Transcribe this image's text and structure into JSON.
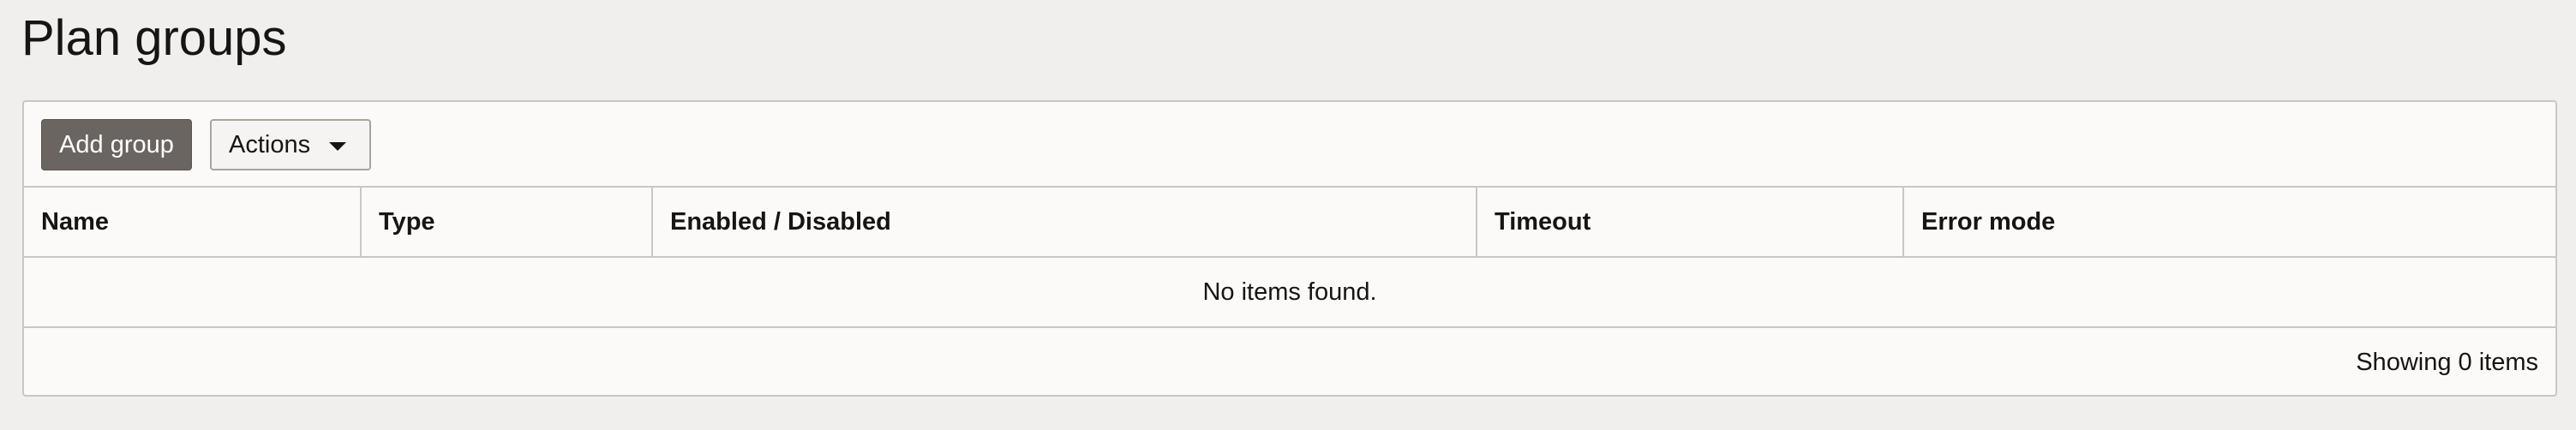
{
  "page": {
    "title": "Plan groups"
  },
  "toolbar": {
    "add_group_label": "Add group",
    "actions_label": "Actions"
  },
  "table": {
    "columns": [
      "Name",
      "Type",
      "Enabled / Disabled",
      "Timeout",
      "Error mode"
    ],
    "rows": [],
    "empty_message": "No items found.",
    "footer_text": "Showing 0 items"
  },
  "colors": {
    "background": "#f1efed",
    "panel": "#fbfaf8",
    "primary_button": "#6b6561",
    "border": "#c9c7c3",
    "text": "#161513"
  },
  "icons": {
    "actions_dropdown": "caret-down-icon"
  }
}
